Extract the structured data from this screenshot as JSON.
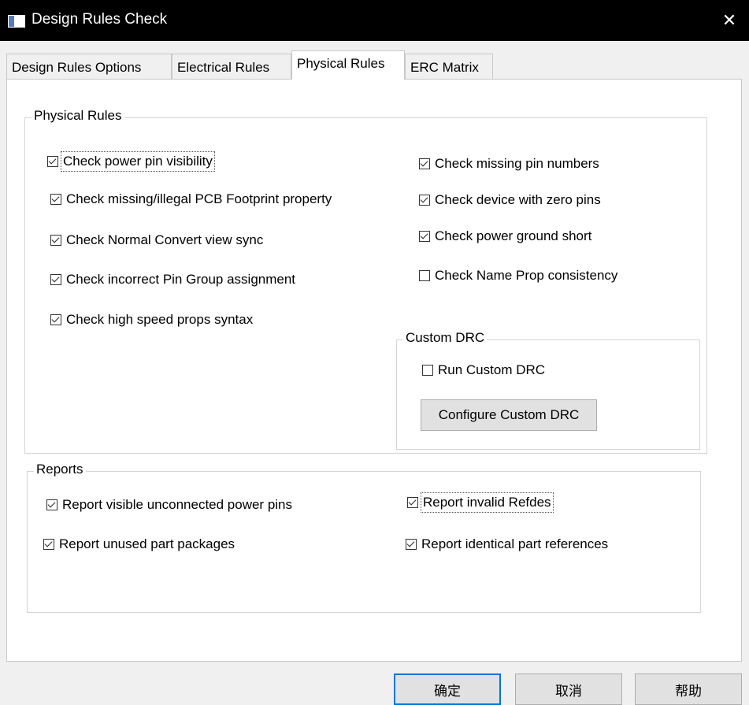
{
  "window": {
    "title": "Design Rules Check",
    "close_glyph": "✕"
  },
  "tabs": [
    {
      "label": "Design Rules Options"
    },
    {
      "label": "Electrical Rules"
    },
    {
      "label": "Physical Rules"
    },
    {
      "label": "ERC Matrix"
    }
  ],
  "active_tab": "Physical Rules",
  "physical_rules": {
    "legend": "Physical Rules",
    "left": [
      {
        "label": "Check power pin visibility",
        "checked": true
      },
      {
        "label": "Check missing/illegal PCB Footprint property",
        "checked": true
      },
      {
        "label": "Check Normal Convert view sync",
        "checked": true
      },
      {
        "label": "Check incorrect Pin Group assignment",
        "checked": true
      },
      {
        "label": "Check high speed props syntax",
        "checked": true
      }
    ],
    "right": [
      {
        "label": "Check missing pin numbers",
        "checked": true
      },
      {
        "label": "Check device with zero pins",
        "checked": true
      },
      {
        "label": "Check power ground short",
        "checked": true
      },
      {
        "label": "Check Name Prop consistency",
        "checked": false
      }
    ]
  },
  "custom_drc": {
    "legend": "Custom DRC",
    "run": {
      "label": "Run Custom DRC",
      "checked": false
    },
    "configure_label": "Configure Custom DRC"
  },
  "reports": {
    "legend": "Reports",
    "items": [
      {
        "label": "Report visible unconnected power pins",
        "checked": true
      },
      {
        "label": "Report invalid Refdes",
        "checked": true
      },
      {
        "label": "Report unused part packages",
        "checked": true
      },
      {
        "label": "Report identical part references",
        "checked": true
      }
    ]
  },
  "buttons": {
    "ok": "确定",
    "cancel": "取消",
    "help": "帮助"
  },
  "colors": {
    "title_bar": "#000000",
    "default_button_border": "#0078d7",
    "window_bg": "#f0f0f0"
  }
}
